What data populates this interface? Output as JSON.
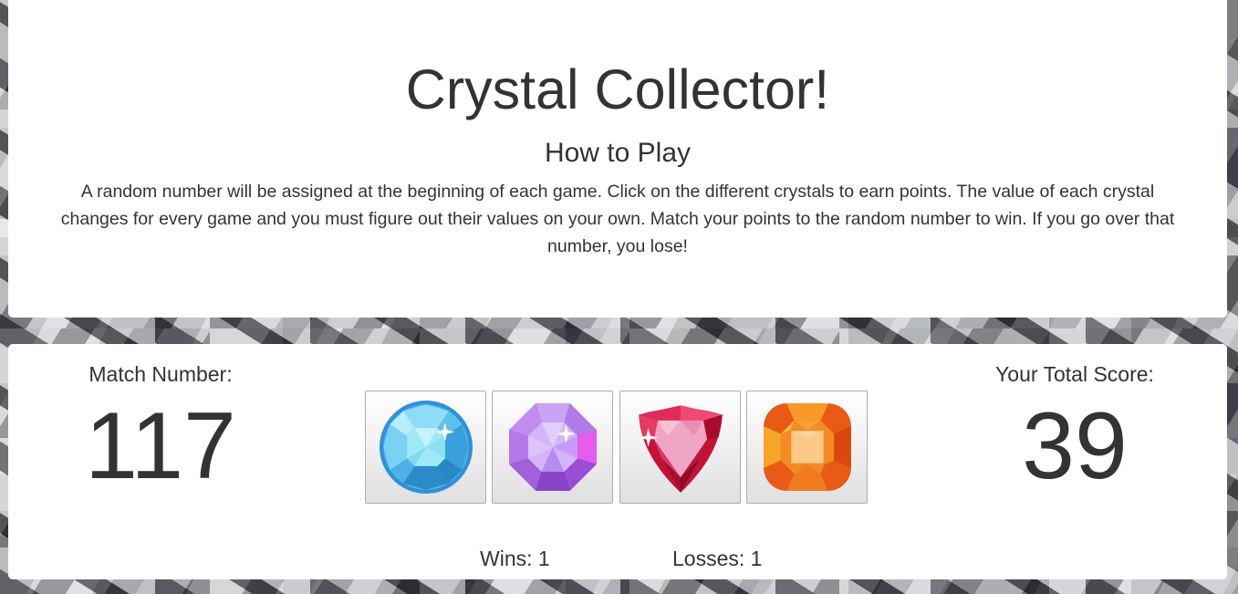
{
  "header": {
    "title": "Crystal Collector!",
    "subtitle": "How to Play",
    "instructions": "A random number will be assigned at the beginning of each game. Click on the different crystals to earn points. The value of each crystal changes for every game and you must figure out their values on your own. Match your points to the random number to win. If you go over that number, you lose!"
  },
  "game": {
    "match_label": "Match Number:",
    "match_number": "117",
    "score_label": "Your Total Score:",
    "total_score": "39",
    "wins_text": "Wins: 1",
    "losses_text": "Losses: 1",
    "crystals": [
      {
        "icon": "blue-round-crystal-icon",
        "color": "#3aa6e8"
      },
      {
        "icon": "purple-octagon-crystal-icon",
        "color": "#a05ad8"
      },
      {
        "icon": "red-trillion-crystal-icon",
        "color": "#d4163f"
      },
      {
        "icon": "orange-cushion-crystal-icon",
        "color": "#f07a1e"
      }
    ]
  }
}
